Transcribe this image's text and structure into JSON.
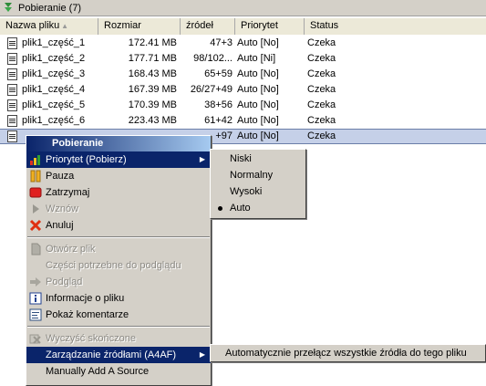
{
  "title_bar": {
    "title": "Pobieranie (7)",
    "icon": "download-arrow-icon"
  },
  "columns": [
    "Nazwa pliku",
    "Rozmiar",
    "źródeł",
    "Priorytet",
    "Status"
  ],
  "rows": [
    {
      "name": "plik1_część_1",
      "size": "172.41 MB",
      "sources": "47+3",
      "priority": "Auto [No]",
      "status": "Czeka"
    },
    {
      "name": "plik1_część_2",
      "size": "177.71 MB",
      "sources": "98/102...",
      "priority": "Auto [Ni]",
      "status": "Czeka"
    },
    {
      "name": "plik1_część_3",
      "size": "168.43 MB",
      "sources": "65+59",
      "priority": "Auto [No]",
      "status": "Czeka"
    },
    {
      "name": "plik1_część_4",
      "size": "167.39 MB",
      "sources": "26/27+49",
      "priority": "Auto [No]",
      "status": "Czeka"
    },
    {
      "name": "plik1_część_5",
      "size": "170.39 MB",
      "sources": "38+56",
      "priority": "Auto [No]",
      "status": "Czeka"
    },
    {
      "name": "plik1_część_6",
      "size": "223.43 MB",
      "sources": "61+42",
      "priority": "Auto [No]",
      "status": "Czeka"
    },
    {
      "name": "",
      "size": "",
      "sources": "+97",
      "priority": "Auto [No]",
      "status": "Czeka"
    }
  ],
  "context_menu": {
    "title": "Pobieranie",
    "items": [
      {
        "label": "Priorytet (Pobierz)",
        "icon": "priority-bars-icon",
        "enabled": true,
        "submenu": true
      },
      {
        "label": "Pauza",
        "icon": "pause-icon",
        "enabled": true
      },
      {
        "label": "Zatrzymaj",
        "icon": "stop-icon",
        "enabled": true
      },
      {
        "label": "Wznów",
        "icon": "resume-icon",
        "enabled": false
      },
      {
        "label": "Anuluj",
        "icon": "cancel-x-icon",
        "enabled": true
      },
      {
        "label": "Otwórz plik",
        "icon": "open-file-icon",
        "enabled": false
      },
      {
        "label": "Części potrzebne do podglądu",
        "icon": "",
        "enabled": false
      },
      {
        "label": "Podgląd",
        "icon": "preview-arrow-icon",
        "enabled": false
      },
      {
        "label": "Informacje o pliku",
        "icon": "info-icon",
        "enabled": true
      },
      {
        "label": "Pokaż komentarze",
        "icon": "comments-icon",
        "enabled": true
      },
      {
        "label": "Wyczyść skończone",
        "icon": "clear-finished-icon",
        "enabled": false
      },
      {
        "label": "Zarządzanie źródłami (A4AF)",
        "icon": "",
        "enabled": true,
        "submenu": true
      },
      {
        "label": "Manually Add A Source",
        "icon": "",
        "enabled": true
      }
    ]
  },
  "priority_submenu": {
    "items": [
      "Niski",
      "Normalny",
      "Wysoki",
      "Auto"
    ],
    "selected": "Auto"
  },
  "a4af_submenu": {
    "items": [
      "Automatycznie przełącz wszystkie źródła do tego pliku"
    ]
  },
  "colors": {
    "highlight": "#0a246a",
    "selected_row": "#c5d0e8",
    "menu_bg": "#d4d0c8"
  }
}
